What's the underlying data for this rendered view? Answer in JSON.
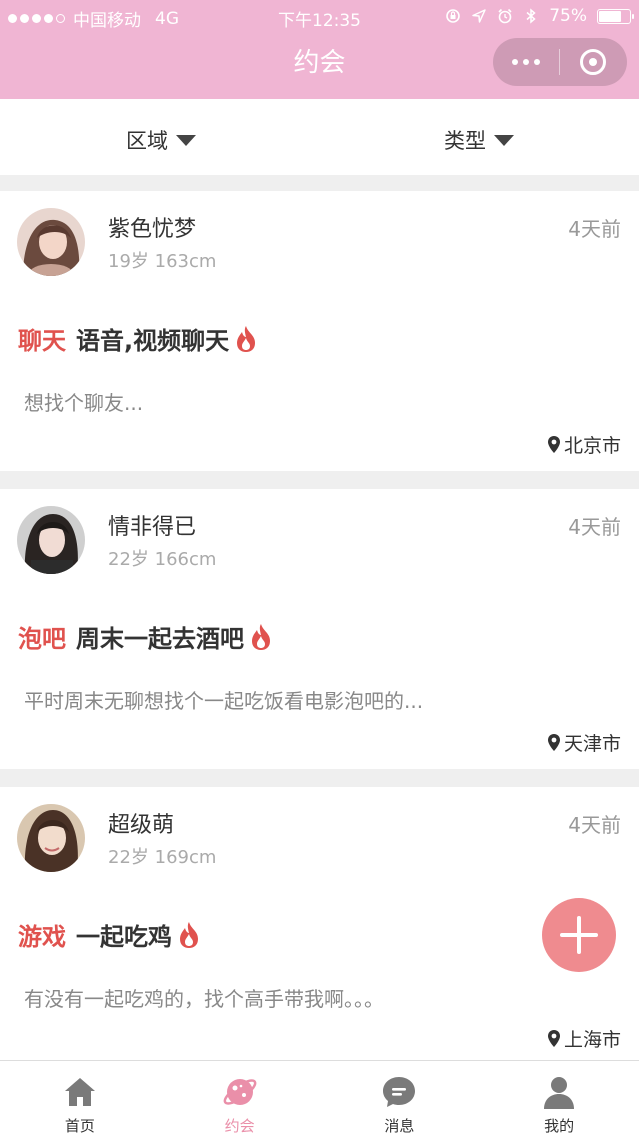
{
  "status_bar": {
    "carrier": "中国移动",
    "network": "4G",
    "time": "下午12:35",
    "battery_percent": "75%",
    "battery_level": 0.75
  },
  "nav": {
    "title": "约会"
  },
  "filters": {
    "area_label": "区域",
    "type_label": "类型"
  },
  "posts": [
    {
      "name": "紫色忧梦",
      "meta": "19岁 163cm",
      "time": "4天前",
      "category": "聊天",
      "title": "语音,视频聊天",
      "description": "想找个聊友...",
      "location": "北京市"
    },
    {
      "name": "情非得已",
      "meta": "22岁 166cm",
      "time": "4天前",
      "category": "泡吧",
      "title": "周末一起去酒吧",
      "description": "平时周末无聊想找个一起吃饭看电影泡吧的...",
      "location": "天津市"
    },
    {
      "name": "超级萌",
      "meta": "22岁 169cm",
      "time": "4天前",
      "category": "游戏",
      "title": "一起吃鸡",
      "description": "有没有一起吃鸡的，找个高手带我啊。。。",
      "location": "上海市"
    }
  ],
  "tabs": [
    {
      "label": "首页",
      "icon": "home-icon"
    },
    {
      "label": "约会",
      "icon": "planet-icon",
      "active": true
    },
    {
      "label": "消息",
      "icon": "message-icon"
    },
    {
      "label": "我的",
      "icon": "user-icon"
    }
  ],
  "colors": {
    "header_pink": "#f0b5d3",
    "category_red": "#e0524e",
    "active_tab_pink": "#ea8fa9",
    "fab_pink": "#ef8b8f"
  }
}
